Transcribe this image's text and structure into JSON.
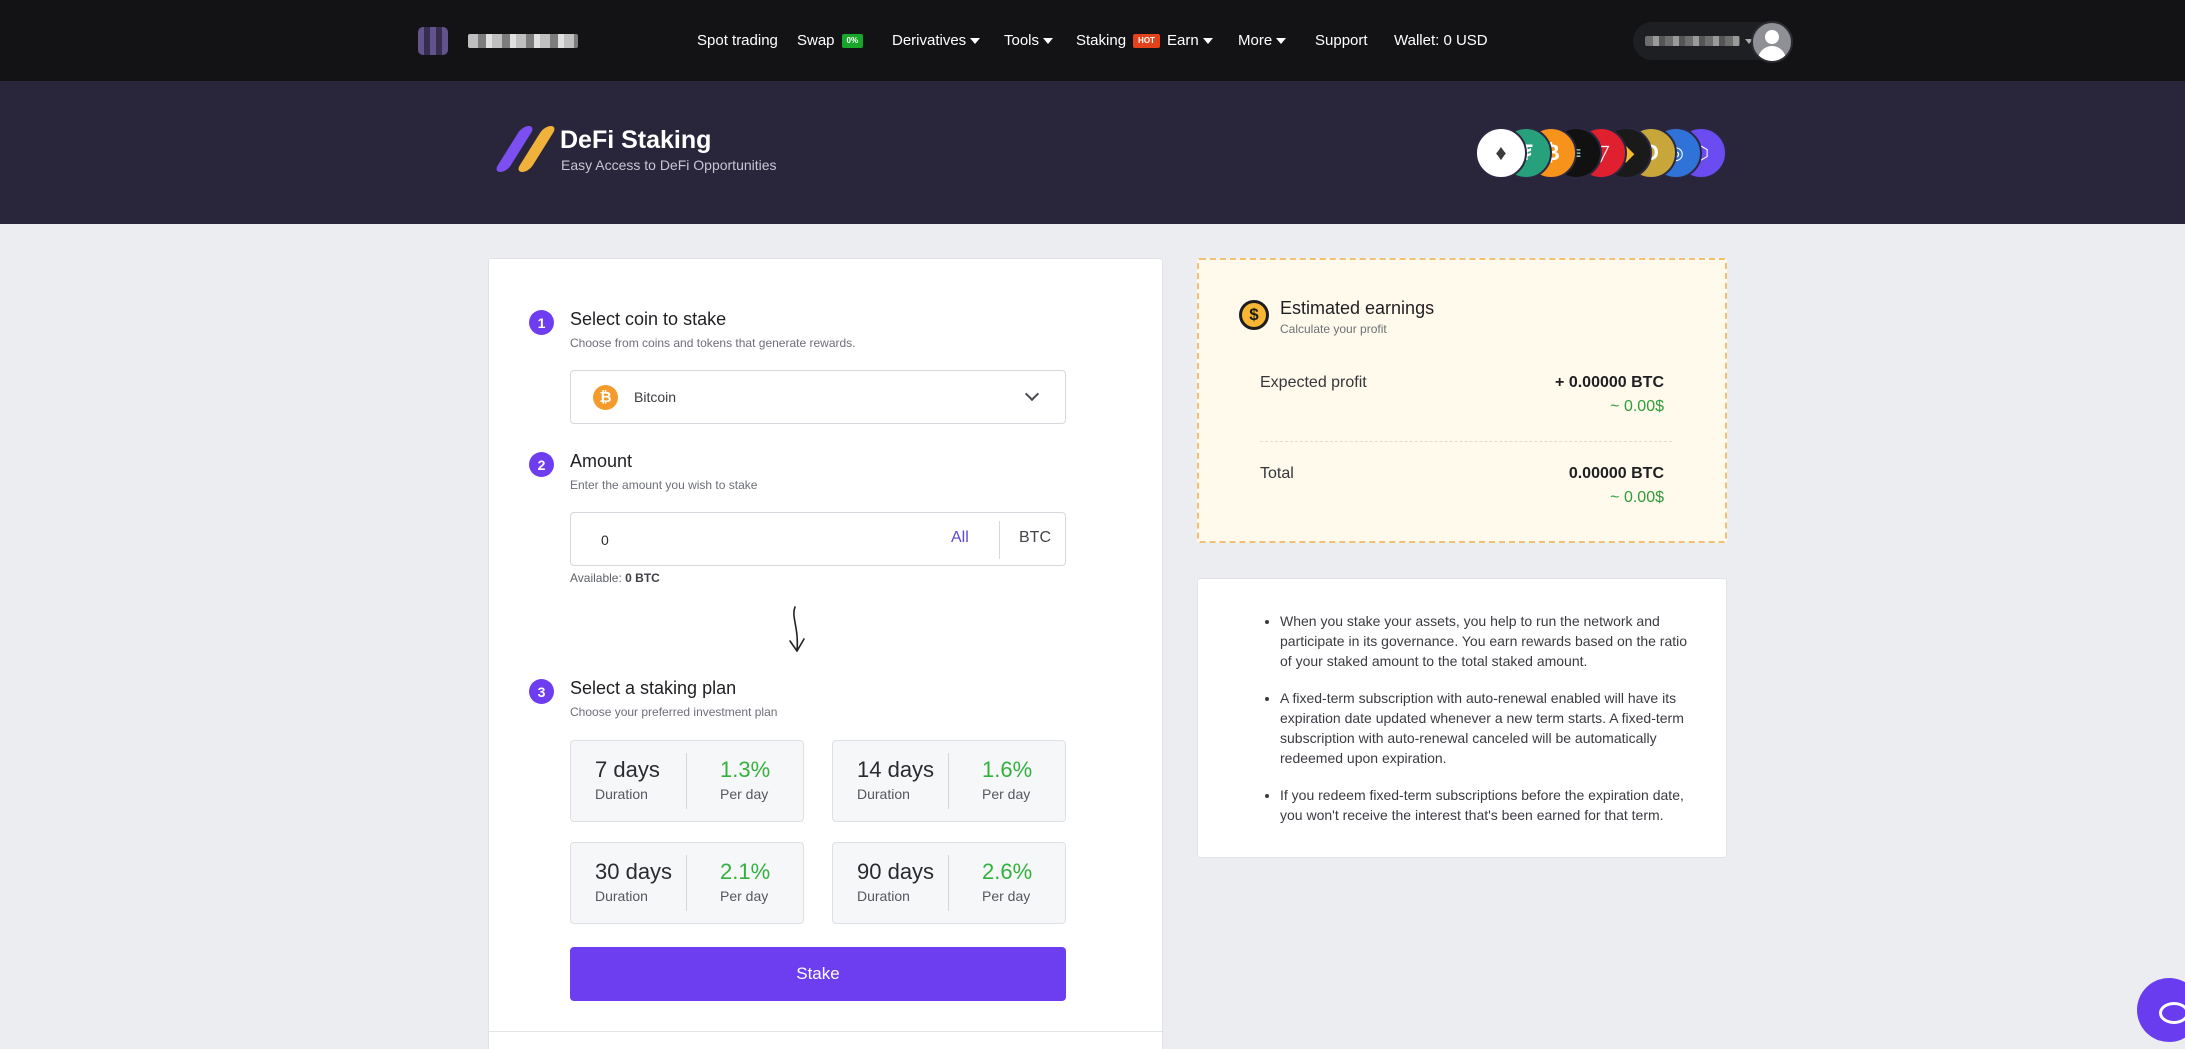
{
  "navbar": {
    "items": [
      {
        "label": "Spot trading"
      },
      {
        "label": "Swap",
        "badge": "0%"
      },
      {
        "label": "Derivatives",
        "dropdown": true
      },
      {
        "label": "Tools",
        "dropdown": true
      },
      {
        "label": "Staking",
        "badge": "HOT"
      },
      {
        "label": "Earn",
        "dropdown": true
      },
      {
        "label": "More",
        "dropdown": true
      },
      {
        "label": "Support"
      },
      {
        "label": "Wallet: 0 USD"
      }
    ]
  },
  "hero": {
    "title": "DeFi Staking",
    "subtitle": "Easy Access to DeFi Opportunities",
    "coin_icons": [
      "ethereum-icon",
      "tether-icon",
      "bitcoin-icon",
      "solana-icon",
      "tron-icon",
      "bnb-icon",
      "dogecoin-icon",
      "cardano-icon",
      "chainlink-icon"
    ]
  },
  "stake_form": {
    "step1": {
      "num": "1",
      "title": "Select coin to stake",
      "subtitle": "Choose from coins and tokens that generate rewards.",
      "selected_coin": "Bitcoin"
    },
    "step2": {
      "num": "2",
      "title": "Amount",
      "subtitle": "Enter the amount you wish to stake",
      "value": "0",
      "all_label": "All",
      "unit": "BTC",
      "available_label": "Available:",
      "available_value": "0 BTC"
    },
    "step3": {
      "num": "3",
      "title": "Select a staking plan",
      "subtitle": "Choose your preferred investment plan"
    },
    "plans": [
      {
        "days": "7 days",
        "duration_label": "Duration",
        "rate": "1.3%",
        "rate_label": "Per day"
      },
      {
        "days": "14 days",
        "duration_label": "Duration",
        "rate": "1.6%",
        "rate_label": "Per day"
      },
      {
        "days": "30 days",
        "duration_label": "Duration",
        "rate": "2.1%",
        "rate_label": "Per day"
      },
      {
        "days": "90 days",
        "duration_label": "Duration",
        "rate": "2.6%",
        "rate_label": "Per day"
      }
    ],
    "stake_button": "Stake"
  },
  "earnings": {
    "title": "Estimated earnings",
    "subtitle": "Calculate your profit",
    "expected_profit_label": "Expected profit",
    "expected_profit_value": "+ 0.00000 BTC",
    "expected_profit_usd": "~ 0.00$",
    "total_label": "Total",
    "total_value": "0.00000 BTC",
    "total_usd": "~ 0.00$"
  },
  "info": {
    "bullets": [
      "When you stake your assets, you help to run the network and participate in its governance. You earn rewards based on the ratio of your staked amount to the total staked amount.",
      "A fixed-term subscription with auto-renewal enabled will have its expiration date updated whenever a new term starts. A fixed-term subscription with auto-renewal canceled will be automatically redeemed upon expiration.",
      "If you redeem fixed-term subscriptions before the expiration date, you won't receive the interest that's been earned for that term."
    ]
  },
  "colors": {
    "accent": "#6d3ef0",
    "positive": "#33b13d",
    "navbar": "#131315",
    "hero": "#29253a"
  }
}
